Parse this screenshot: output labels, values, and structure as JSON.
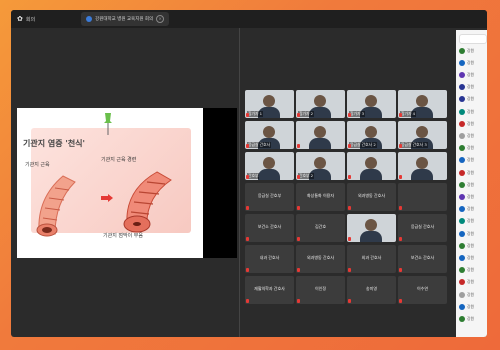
{
  "topbar": {
    "app_label": "회의",
    "meeting_tab": "강원대학교 병원 교육지원 회의"
  },
  "slide": {
    "title": "기관지 염증 '천식'",
    "label_a": "기관지 근육",
    "label_b": "기관지 근육 경련",
    "label_c": "기관지 점막이 부음"
  },
  "gallery": {
    "tiles": [
      {
        "name": "참가자 1",
        "kind": "photo"
      },
      {
        "name": "참가자 2",
        "kind": "photo"
      },
      {
        "name": "참가자 3",
        "kind": "photo"
      },
      {
        "name": "참가자 4",
        "kind": "photo"
      },
      {
        "name": "응급실 간호사",
        "kind": "photo"
      },
      {
        "name": "",
        "kind": "photo"
      },
      {
        "name": "응급실 간호사 2",
        "kind": "photo"
      },
      {
        "name": "응급실 간호사 3",
        "kind": "photo"
      },
      {
        "name": "간호부",
        "kind": "photo"
      },
      {
        "name": "간호부 2",
        "kind": "photo"
      },
      {
        "name": "",
        "kind": "photo"
      },
      {
        "name": "",
        "kind": "photo"
      },
      {
        "name": "응급실 간호부",
        "kind": "dark"
      },
      {
        "name": "화상통화 이용자",
        "kind": "dark"
      },
      {
        "name": "외과병동 간호사",
        "kind": "dark"
      },
      {
        "name": "",
        "kind": "dark"
      },
      {
        "name": "보건소 간호사",
        "kind": "dark"
      },
      {
        "name": "김간호",
        "kind": "dark"
      },
      {
        "name": "",
        "kind": "photo"
      },
      {
        "name": "응급실 간호사",
        "kind": "dark"
      },
      {
        "name": "내과 간호사",
        "kind": "dark"
      },
      {
        "name": "외과병동 간호사",
        "kind": "dark"
      },
      {
        "name": "외과 간호사",
        "kind": "dark"
      },
      {
        "name": "보건소 간호사",
        "kind": "dark"
      },
      {
        "name": "재활의학과 간호사",
        "kind": "dark"
      },
      {
        "name": "이인정",
        "kind": "dark"
      },
      {
        "name": "송미영",
        "kind": "dark"
      },
      {
        "name": "이수연",
        "kind": "dark"
      }
    ]
  },
  "sidebar": {
    "items": [
      {
        "label": "강원",
        "color": "#2e7d32"
      },
      {
        "label": "강원",
        "color": "#1565c0"
      },
      {
        "label": "강원",
        "color": "#5e35b1"
      },
      {
        "label": "강원",
        "color": "#283593"
      },
      {
        "label": "강원",
        "color": "#283593"
      },
      {
        "label": "강원",
        "color": "#00897b"
      },
      {
        "label": "강원",
        "color": "#c62828"
      },
      {
        "label": "강원",
        "color": "#9e9e9e"
      },
      {
        "label": "강원",
        "color": "#2e7d32"
      },
      {
        "label": "강원",
        "color": "#1565c0"
      },
      {
        "label": "강원",
        "color": "#c62828"
      },
      {
        "label": "강원",
        "color": "#2e7d32"
      },
      {
        "label": "강원",
        "color": "#5e35b1"
      },
      {
        "label": "강원",
        "color": "#1565c0"
      },
      {
        "label": "강원",
        "color": "#00897b"
      },
      {
        "label": "강원",
        "color": "#1565c0"
      },
      {
        "label": "강원",
        "color": "#2e7d32"
      },
      {
        "label": "강원",
        "color": "#1565c0"
      },
      {
        "label": "강원",
        "color": "#2e7d32"
      },
      {
        "label": "강원",
        "color": "#c62828"
      },
      {
        "label": "강원",
        "color": "#9e9e9e"
      },
      {
        "label": "강원",
        "color": "#1565c0"
      },
      {
        "label": "강원",
        "color": "#2e7d32"
      }
    ]
  }
}
